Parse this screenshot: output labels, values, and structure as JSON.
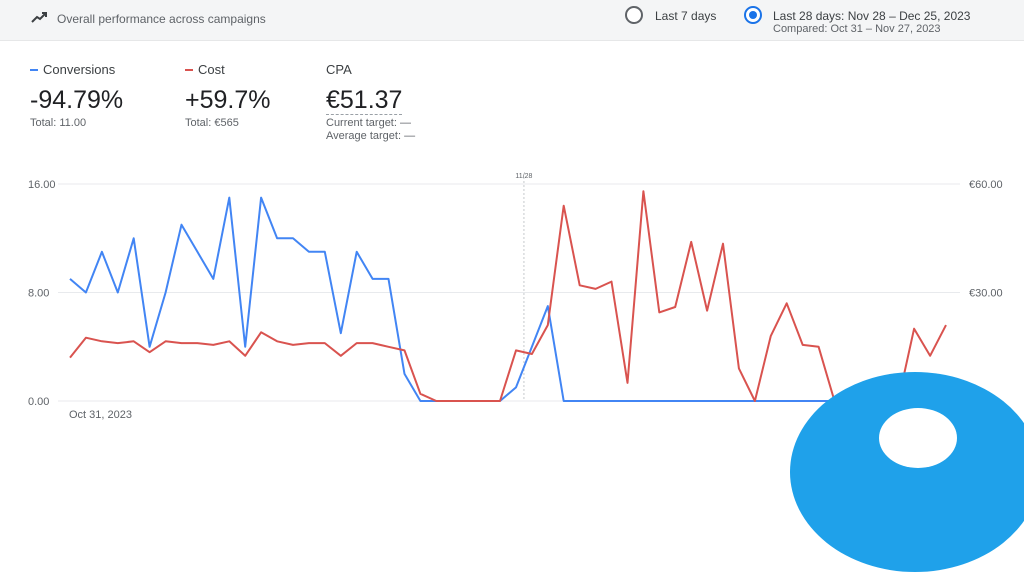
{
  "header": {
    "title": "Overall performance across campaigns",
    "icon": "trending-up-icon",
    "range_options": [
      {
        "label": "Last 7 days",
        "selected": false
      },
      {
        "label": "Last 28 days: Nov 28 – Dec 25, 2023",
        "selected": true
      }
    ],
    "compared": "Compared: Oct 31 – Nov 27, 2023"
  },
  "colors": {
    "conversions": "#4285f4",
    "cost": "#d9534f",
    "accent": "#1a73e8"
  },
  "metrics": {
    "conversions": {
      "label": "Conversions",
      "value": "-94.79%",
      "total": "Total: 11.00"
    },
    "cost": {
      "label": "Cost",
      "value": "+59.7%",
      "total": "Total: €565"
    },
    "cpa": {
      "label": "CPA",
      "value": "€51.37",
      "current_target": "Current target: —",
      "average_target": "Average target: —"
    }
  },
  "chart_data": {
    "type": "line",
    "marker_label": "11/28",
    "x_start_label": "Oct 31, 2023",
    "left_ticks": [
      "16.00",
      "8.00",
      "0.00"
    ],
    "right_ticks": [
      "€60.00",
      "€30.00"
    ],
    "ylim_left": [
      0,
      16
    ],
    "ylim_right": [
      0,
      60
    ],
    "grid": true,
    "marker_index": 28,
    "series": [
      {
        "name": "Conversions",
        "axis": "left",
        "values": [
          9,
          8,
          11,
          8,
          12,
          4,
          8,
          13,
          11,
          9,
          15,
          4,
          15,
          12,
          12,
          11,
          11,
          5,
          11,
          9,
          9,
          2,
          0,
          0,
          0,
          0,
          0,
          0,
          1,
          4,
          7,
          0,
          0,
          0,
          0,
          0,
          0,
          0,
          0,
          0,
          0,
          0,
          0,
          0,
          0,
          0,
          0,
          0,
          0,
          0,
          0,
          0,
          0,
          0,
          0,
          0
        ]
      },
      {
        "name": "Cost",
        "axis": "right",
        "values": [
          12,
          17.5,
          16.5,
          16,
          16.5,
          13.5,
          16.5,
          16,
          16,
          15.5,
          16.5,
          12.5,
          19,
          16.5,
          15.5,
          16,
          16,
          12.5,
          16,
          16,
          15,
          14,
          2,
          0,
          0,
          0,
          0,
          0,
          14,
          13,
          21,
          54,
          32,
          31,
          33,
          5,
          58,
          24.5,
          26,
          44,
          25,
          43.5,
          9,
          0,
          18,
          27,
          15.5,
          15,
          0,
          0,
          0,
          0,
          0,
          20,
          12.5,
          21
        ]
      }
    ]
  }
}
